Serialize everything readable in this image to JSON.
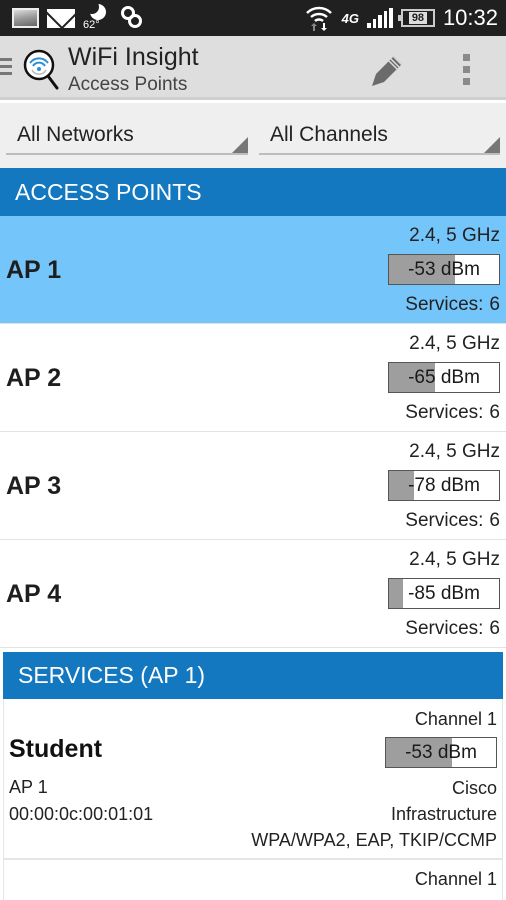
{
  "status_bar": {
    "notifications": [
      "gallery-icon",
      "mail-icon",
      "weather-night-icon",
      "sync-icon"
    ],
    "temperature": "62°",
    "network_type": "4G",
    "battery": "98",
    "time": "10:32"
  },
  "action_bar": {
    "title": "WiFi Insight",
    "subtitle": "Access Points",
    "icons": [
      "hamburger-menu-icon",
      "wifi-search-logo-icon",
      "pencil-edit-icon",
      "overflow-menu-icon"
    ]
  },
  "filters": {
    "network": "All Networks",
    "channel": "All Channels"
  },
  "colors": {
    "header_blue": "#1378bf",
    "selected_row": "#74c5fa",
    "signal_fill": "#9e9e9e",
    "action_bar": "#dedede"
  },
  "access_points": {
    "header": "ACCESS POINTS",
    "items": [
      {
        "name": "AP 1",
        "bands": "2.4, 5 GHz",
        "signal": "-53 dBm",
        "signal_level": 0.6,
        "services_label": "Services:",
        "services_count": "6",
        "selected": true
      },
      {
        "name": "AP 2",
        "bands": "2.4, 5 GHz",
        "signal": "-65 dBm",
        "signal_level": 0.42,
        "services_label": "Services:",
        "services_count": "6",
        "selected": false
      },
      {
        "name": "AP 3",
        "bands": "2.4, 5 GHz",
        "signal": "-78 dBm",
        "signal_level": 0.23,
        "services_label": "Services:",
        "services_count": "6",
        "selected": false
      },
      {
        "name": "AP 4",
        "bands": "2.4, 5 GHz",
        "signal": "-85 dBm",
        "signal_level": 0.13,
        "services_label": "Services:",
        "services_count": "6",
        "selected": false
      }
    ]
  },
  "services": {
    "header": "SERVICES (AP 1)",
    "items": [
      {
        "ssid": "Student",
        "ap": "AP 1",
        "bssid": "00:00:0c:00:01:01",
        "channel": "Channel 1",
        "signal": "-53 dBm",
        "signal_level": 0.6,
        "vendor": "Cisco",
        "mode": "Infrastructure",
        "security": "WPA/WPA2, EAP, TKIP/CCMP"
      },
      {
        "channel": "Channel 1"
      }
    ]
  }
}
